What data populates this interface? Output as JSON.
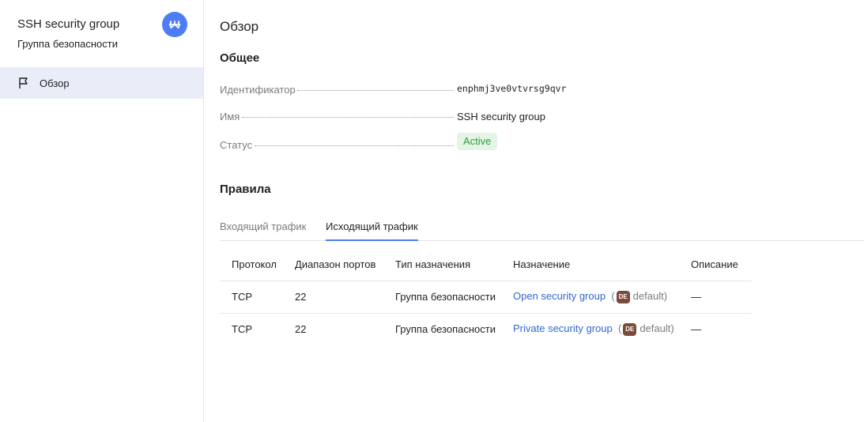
{
  "sidebar": {
    "title": "SSH security group",
    "subtitle": "Группа безопасности",
    "badge_color": "#4d7df2",
    "items": [
      {
        "label": "Обзор",
        "icon": "flag-icon",
        "active": true
      }
    ]
  },
  "main": {
    "title": "Обзор",
    "general": {
      "heading": "Общее",
      "props": [
        {
          "key": "Идентификатор",
          "value": "enphmj3ve0vtvrsg9qvr"
        },
        {
          "key": "Имя",
          "value": "SSH security group"
        },
        {
          "key": "Статус",
          "value": "Active"
        }
      ]
    },
    "rules": {
      "heading": "Правила",
      "tabs": [
        {
          "label": "Входящий трафик",
          "active": false
        },
        {
          "label": "Исходящий трафик",
          "active": true
        }
      ],
      "columns": [
        "Протокол",
        "Диапазон портов",
        "Тип назначения",
        "Назначение",
        "Описание"
      ],
      "rows": [
        {
          "protocol": "TCP",
          "ports": "22",
          "dest_type": "Группа безопасности",
          "dest_link": "Open security group",
          "folder_badge": "DE",
          "folder": "default",
          "description": "—"
        },
        {
          "protocol": "TCP",
          "ports": "22",
          "dest_type": "Группа безопасности",
          "dest_link": "Private security group",
          "folder_badge": "DE",
          "folder": "default",
          "description": "—"
        }
      ]
    }
  },
  "colors": {
    "accent": "#4d7df2",
    "link": "#3366cc",
    "status_active_bg": "#e5f5e5",
    "status_active_text": "#2c9c3c",
    "folder_badge_bg": "#7a4a3a",
    "sidebar_active_bg": "#e8edf8"
  }
}
